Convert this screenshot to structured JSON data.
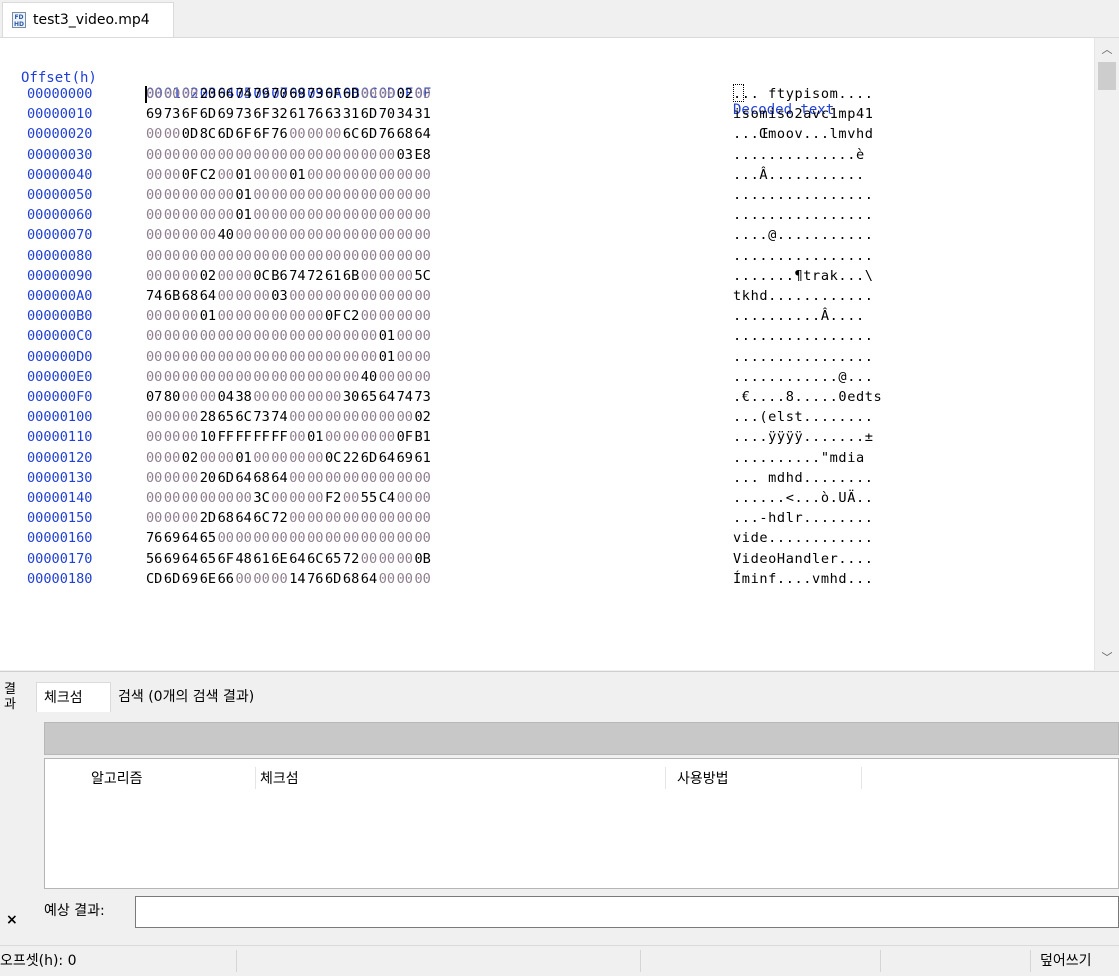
{
  "tab": {
    "file_name": "test3_video.mp4",
    "icon": "file-icon",
    "icon_label": "FD\nHD"
  },
  "hex": {
    "offset_header": "Offset(h)",
    "column_headers": [
      "00",
      "01",
      "02",
      "03",
      "04",
      "05",
      "06",
      "07",
      "08",
      "09",
      "0A",
      "0B",
      "0C",
      "0D",
      "0E",
      "0F"
    ],
    "decoded_header": "Decoded text",
    "rows": [
      {
        "offset": "00000000",
        "bytes": [
          "00",
          "00",
          "00",
          "20",
          "66",
          "74",
          "79",
          "70",
          "69",
          "73",
          "6F",
          "6D",
          "00",
          "00",
          "02",
          "00"
        ],
        "text": "... ftypisom...."
      },
      {
        "offset": "00000010",
        "bytes": [
          "69",
          "73",
          "6F",
          "6D",
          "69",
          "73",
          "6F",
          "32",
          "61",
          "76",
          "63",
          "31",
          "6D",
          "70",
          "34",
          "31"
        ],
        "text": "isomiso2avc1mp41"
      },
      {
        "offset": "00000020",
        "bytes": [
          "00",
          "00",
          "0D",
          "8C",
          "6D",
          "6F",
          "6F",
          "76",
          "00",
          "00",
          "00",
          "6C",
          "6D",
          "76",
          "68",
          "64"
        ],
        "text": "...Œmoov...lmvhd"
      },
      {
        "offset": "00000030",
        "bytes": [
          "00",
          "00",
          "00",
          "00",
          "00",
          "00",
          "00",
          "00",
          "00",
          "00",
          "00",
          "00",
          "00",
          "00",
          "03",
          "E8"
        ],
        "text": "..............è"
      },
      {
        "offset": "00000040",
        "bytes": [
          "00",
          "00",
          "0F",
          "C2",
          "00",
          "01",
          "00",
          "00",
          "01",
          "00",
          "00",
          "00",
          "00",
          "00",
          "00",
          "00"
        ],
        "text": "...Â..........."
      },
      {
        "offset": "00000050",
        "bytes": [
          "00",
          "00",
          "00",
          "00",
          "00",
          "01",
          "00",
          "00",
          "00",
          "00",
          "00",
          "00",
          "00",
          "00",
          "00",
          "00"
        ],
        "text": "................"
      },
      {
        "offset": "00000060",
        "bytes": [
          "00",
          "00",
          "00",
          "00",
          "00",
          "01",
          "00",
          "00",
          "00",
          "00",
          "00",
          "00",
          "00",
          "00",
          "00",
          "00"
        ],
        "text": "................"
      },
      {
        "offset": "00000070",
        "bytes": [
          "00",
          "00",
          "00",
          "00",
          "40",
          "00",
          "00",
          "00",
          "00",
          "00",
          "00",
          "00",
          "00",
          "00",
          "00",
          "00"
        ],
        "text": "....@..........."
      },
      {
        "offset": "00000080",
        "bytes": [
          "00",
          "00",
          "00",
          "00",
          "00",
          "00",
          "00",
          "00",
          "00",
          "00",
          "00",
          "00",
          "00",
          "00",
          "00",
          "00"
        ],
        "text": "................"
      },
      {
        "offset": "00000090",
        "bytes": [
          "00",
          "00",
          "00",
          "02",
          "00",
          "00",
          "0C",
          "B6",
          "74",
          "72",
          "61",
          "6B",
          "00",
          "00",
          "00",
          "5C"
        ],
        "text": ".......¶trak...\\"
      },
      {
        "offset": "000000A0",
        "bytes": [
          "74",
          "6B",
          "68",
          "64",
          "00",
          "00",
          "00",
          "03",
          "00",
          "00",
          "00",
          "00",
          "00",
          "00",
          "00",
          "00"
        ],
        "text": "tkhd............"
      },
      {
        "offset": "000000B0",
        "bytes": [
          "00",
          "00",
          "00",
          "01",
          "00",
          "00",
          "00",
          "00",
          "00",
          "00",
          "0F",
          "C2",
          "00",
          "00",
          "00",
          "00"
        ],
        "text": "..........Â...."
      },
      {
        "offset": "000000C0",
        "bytes": [
          "00",
          "00",
          "00",
          "00",
          "00",
          "00",
          "00",
          "00",
          "00",
          "00",
          "00",
          "00",
          "00",
          "01",
          "00",
          "00"
        ],
        "text": "................"
      },
      {
        "offset": "000000D0",
        "bytes": [
          "00",
          "00",
          "00",
          "00",
          "00",
          "00",
          "00",
          "00",
          "00",
          "00",
          "00",
          "00",
          "00",
          "01",
          "00",
          "00"
        ],
        "text": "................"
      },
      {
        "offset": "000000E0",
        "bytes": [
          "00",
          "00",
          "00",
          "00",
          "00",
          "00",
          "00",
          "00",
          "00",
          "00",
          "00",
          "00",
          "40",
          "00",
          "00",
          "00"
        ],
        "text": "............@..."
      },
      {
        "offset": "000000F0",
        "bytes": [
          "07",
          "80",
          "00",
          "00",
          "04",
          "38",
          "00",
          "00",
          "00",
          "00",
          "00",
          "30",
          "65",
          "64",
          "74",
          "73"
        ],
        "text": ".€....8.....0edts"
      },
      {
        "offset": "00000100",
        "bytes": [
          "00",
          "00",
          "00",
          "28",
          "65",
          "6C",
          "73",
          "74",
          "00",
          "00",
          "00",
          "00",
          "00",
          "00",
          "00",
          "02"
        ],
        "text": "...(elst........"
      },
      {
        "offset": "00000110",
        "bytes": [
          "00",
          "00",
          "00",
          "10",
          "FF",
          "FF",
          "FF",
          "FF",
          "00",
          "01",
          "00",
          "00",
          "00",
          "00",
          "0F",
          "B1"
        ],
        "text": "....ÿÿÿÿ.......±"
      },
      {
        "offset": "00000120",
        "bytes": [
          "00",
          "00",
          "02",
          "00",
          "00",
          "01",
          "00",
          "00",
          "00",
          "00",
          "0C",
          "22",
          "6D",
          "64",
          "69",
          "61"
        ],
        "text": "..........\"mdia"
      },
      {
        "offset": "00000130",
        "bytes": [
          "00",
          "00",
          "00",
          "20",
          "6D",
          "64",
          "68",
          "64",
          "00",
          "00",
          "00",
          "00",
          "00",
          "00",
          "00",
          "00"
        ],
        "text": "... mdhd........"
      },
      {
        "offset": "00000140",
        "bytes": [
          "00",
          "00",
          "00",
          "00",
          "00",
          "00",
          "3C",
          "00",
          "00",
          "00",
          "F2",
          "00",
          "55",
          "C4",
          "00",
          "00"
        ],
        "text": "......<...ò.UÄ.."
      },
      {
        "offset": "00000150",
        "bytes": [
          "00",
          "00",
          "00",
          "2D",
          "68",
          "64",
          "6C",
          "72",
          "00",
          "00",
          "00",
          "00",
          "00",
          "00",
          "00",
          "00"
        ],
        "text": "...-hdlr........"
      },
      {
        "offset": "00000160",
        "bytes": [
          "76",
          "69",
          "64",
          "65",
          "00",
          "00",
          "00",
          "00",
          "00",
          "00",
          "00",
          "00",
          "00",
          "00",
          "00",
          "00"
        ],
        "text": "vide............"
      },
      {
        "offset": "00000170",
        "bytes": [
          "56",
          "69",
          "64",
          "65",
          "6F",
          "48",
          "61",
          "6E",
          "64",
          "6C",
          "65",
          "72",
          "00",
          "00",
          "00",
          "0B"
        ],
        "text": "VideoHandler...."
      },
      {
        "offset": "00000180",
        "bytes": [
          "CD",
          "6D",
          "69",
          "6E",
          "66",
          "00",
          "00",
          "00",
          "14",
          "76",
          "6D",
          "68",
          "64",
          "00",
          "00",
          "00"
        ],
        "text": "Íminf....vmhd..."
      }
    ]
  },
  "results": {
    "side_caption": "결과",
    "close_label": "×",
    "tabs": [
      {
        "label": "체크섬",
        "active": true
      },
      {
        "label": "검색 (0개의 검색 결과)",
        "active": false
      }
    ],
    "columns": [
      "알고리즘",
      "체크섬",
      "사용방법"
    ],
    "expected_label": "예상 결과:",
    "expected_value": ""
  },
  "status": {
    "offset_text": "오프셋(h): 0",
    "mode_text": "덮어쓰기"
  },
  "colors": {
    "offset_blue": "#1f3fd6",
    "zero_byte": "#8f7e8f",
    "nonzero_byte": "#000000"
  }
}
